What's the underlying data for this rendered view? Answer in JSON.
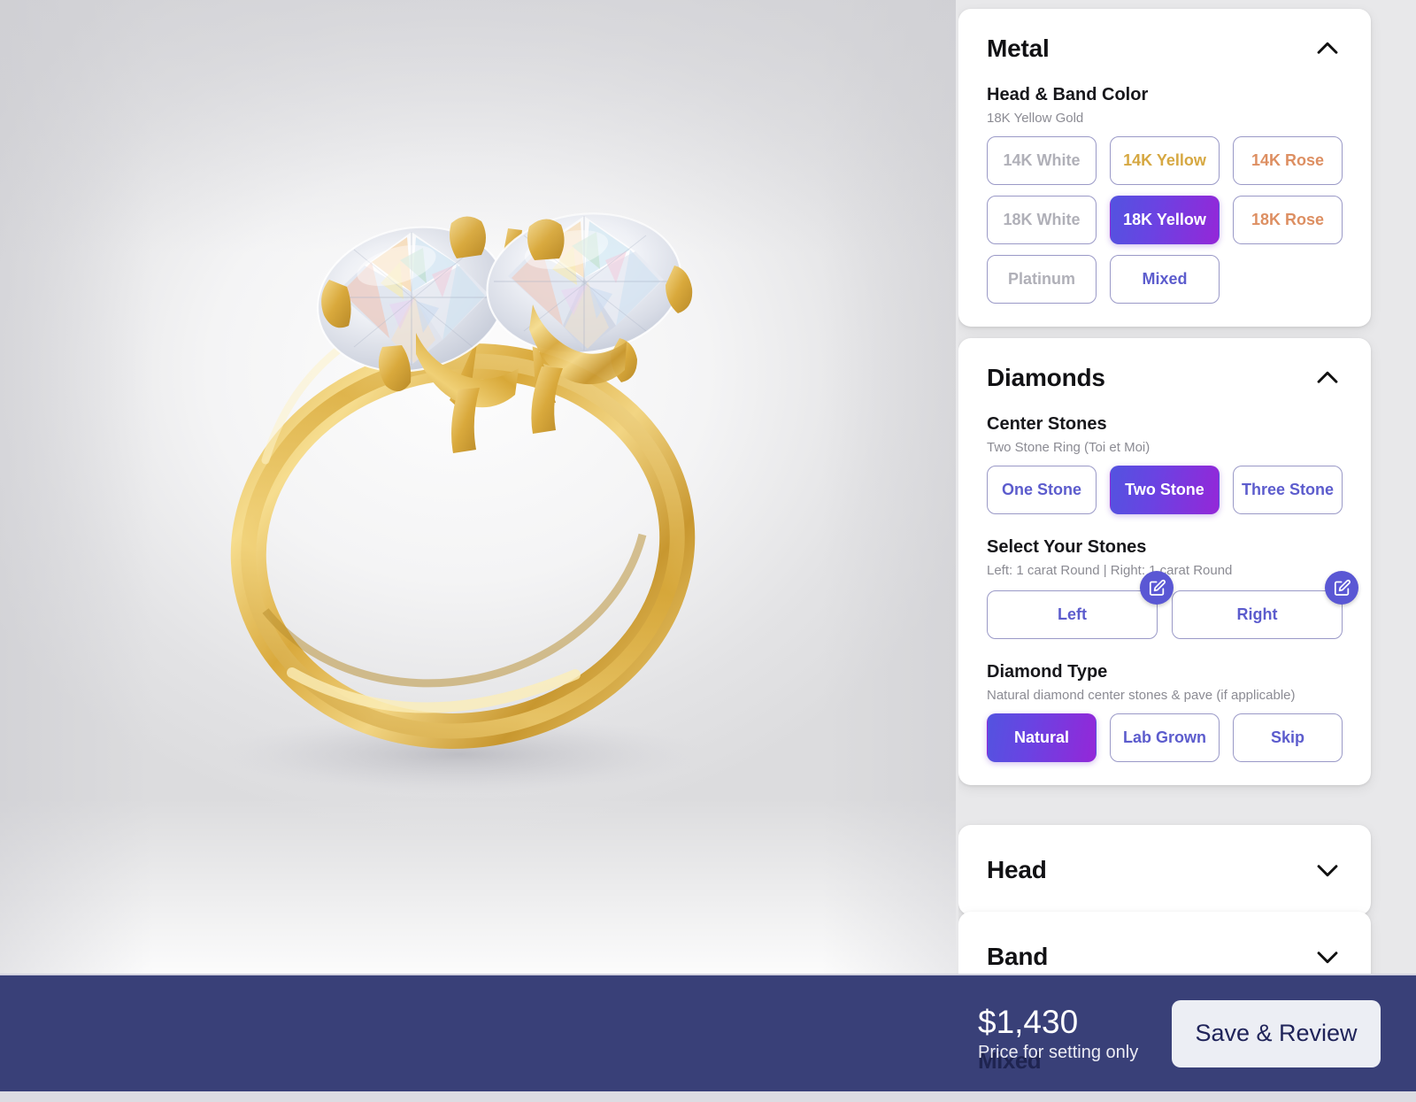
{
  "viewer": {
    "product_name": "Two Stone Ring (Toi et Moi)",
    "metal_rendered": "18K Yellow Gold",
    "alt": "gold-two-stone-ring-render"
  },
  "sidebar": {
    "sections": [
      {
        "id": "metal",
        "title": "Metal",
        "chevron": "chevron-up-icon",
        "expanded": true,
        "groups": [
          {
            "label": "Head & Band Color",
            "sub": "18K Yellow Gold",
            "options": [
              {
                "label": "14K White",
                "state": "muted",
                "selected": false
              },
              {
                "label": "14K Yellow",
                "state": "gold",
                "selected": false
              },
              {
                "label": "14K Rose",
                "state": "rose",
                "selected": false
              },
              {
                "label": "18K White",
                "state": "muted",
                "selected": false
              },
              {
                "label": "18K Yellow",
                "state": "selected",
                "selected": true
              },
              {
                "label": "18K Rose",
                "state": "rose",
                "selected": false
              },
              {
                "label": "Platinum",
                "state": "muted",
                "selected": false
              },
              {
                "label": "Mixed",
                "state": "default",
                "selected": false
              }
            ]
          }
        ]
      },
      {
        "id": "diamonds",
        "title": "Diamonds",
        "chevron": "chevron-up-icon",
        "expanded": true,
        "groups": [
          {
            "label": "Center Stones",
            "sub": "Two Stone Ring (Toi et Moi)",
            "options": [
              {
                "label": "One Stone",
                "state": "default",
                "selected": false
              },
              {
                "label": "Two Stone",
                "state": "selected",
                "selected": true
              },
              {
                "label": "Three Stone",
                "state": "default",
                "selected": false
              }
            ]
          },
          {
            "label": "Select Your Stones",
            "sub": "Left: 1 carat Round | Right: 1 carat Round",
            "stones": [
              {
                "label": "Left",
                "edit_icon": "edit-square-icon"
              },
              {
                "label": "Right",
                "edit_icon": "edit-square-icon"
              }
            ]
          },
          {
            "label": "Diamond Type",
            "sub": "Natural diamond center stones & pave (if applicable)",
            "options": [
              {
                "label": "Natural",
                "state": "selected",
                "selected": true
              },
              {
                "label": "Lab Grown",
                "state": "default",
                "selected": false
              },
              {
                "label": "Skip",
                "state": "default",
                "selected": false
              }
            ]
          }
        ]
      },
      {
        "id": "head",
        "title": "Head",
        "chevron": "chevron-down-icon",
        "expanded": false,
        "groups": []
      },
      {
        "id": "band",
        "title": "Band",
        "chevron": "chevron-down-icon",
        "expanded": false,
        "groups": []
      }
    ]
  },
  "bottombar": {
    "price": "$1,430",
    "price_note": "Price for setting only",
    "ghost_text": "Mixed",
    "save_label": "Save & Review"
  },
  "colors": {
    "accent_start": "#5353e0",
    "accent_end": "#9427d8",
    "accent_text": "#5c5ccd",
    "gold_text": "#d6a842",
    "rose_text": "#dd8f62",
    "muted_text": "#b0b0b8",
    "bar_bg": "#394078",
    "save_btn_bg": "#eceef4",
    "save_btn_text": "#20245a",
    "card_bg": "#ffffff",
    "page_bg": "#e8e8ea"
  }
}
